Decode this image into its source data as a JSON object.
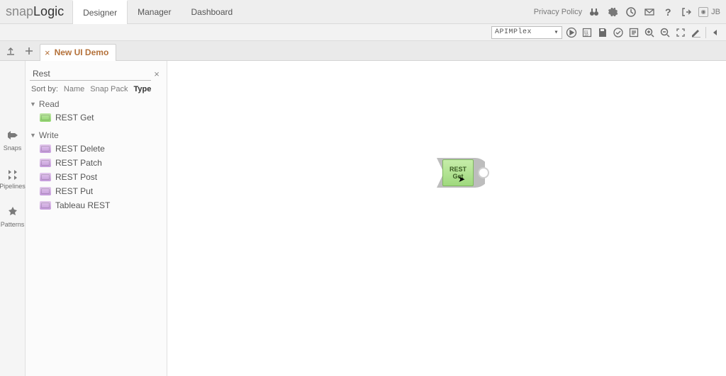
{
  "logo": {
    "part1": "snap",
    "part2": "Logic"
  },
  "app_tabs": {
    "designer": "Designer",
    "manager": "Manager",
    "dashboard": "Dashboard"
  },
  "top_right": {
    "privacy": "Privacy Policy",
    "user_initials": "JB"
  },
  "toolbar": {
    "pipeline_selected": "APIMPlex"
  },
  "filetab": {
    "name": "New UI Demo"
  },
  "rail": {
    "snaps": "Snaps",
    "pipelines": "Pipelines",
    "patterns": "Patterns"
  },
  "catalog": {
    "search_value": "Rest",
    "sort_label": "Sort by:",
    "sort_options": {
      "name": "Name",
      "snap_pack": "Snap Pack",
      "type": "Type"
    },
    "categories": [
      {
        "label": "Read",
        "items": [
          {
            "label": "REST Get",
            "color": "green"
          }
        ]
      },
      {
        "label": "Write",
        "items": [
          {
            "label": "REST Delete",
            "color": "purple"
          },
          {
            "label": "REST Patch",
            "color": "purple"
          },
          {
            "label": "REST Post",
            "color": "purple"
          },
          {
            "label": "REST Put",
            "color": "purple"
          },
          {
            "label": "Tableau REST",
            "color": "purple"
          }
        ]
      }
    ]
  },
  "canvas": {
    "node_label": "REST Get"
  }
}
